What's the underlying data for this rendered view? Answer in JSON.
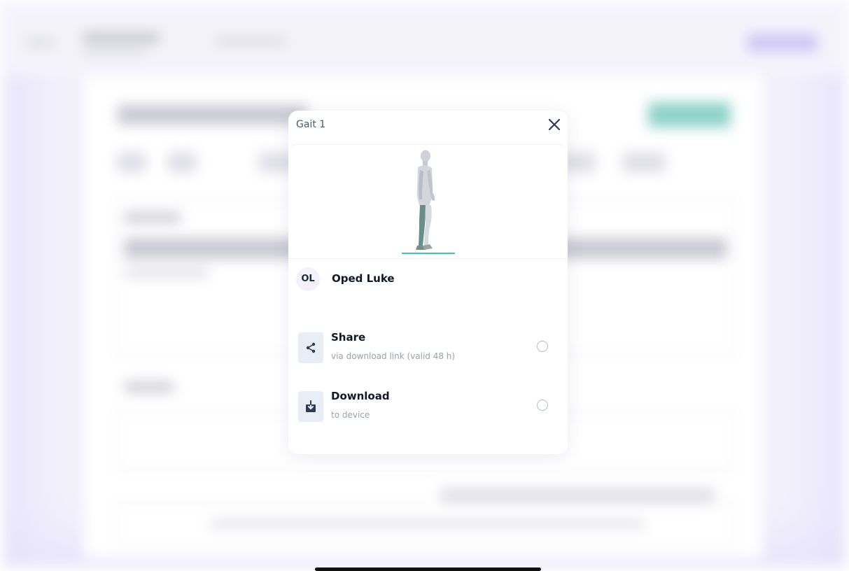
{
  "modal": {
    "title": "Gait 1",
    "close_icon": "close-icon"
  },
  "preview": {
    "figure_icon": "walking-figure-icon",
    "accent_color": "#3fc1b5"
  },
  "user": {
    "initials": "OL",
    "name": "Oped Luke"
  },
  "options": [
    {
      "icon": "share-icon",
      "title": "Share",
      "subtitle": "via download link (valid 48 h)",
      "selected": false
    },
    {
      "icon": "download-icon",
      "title": "Download",
      "subtitle": "to device",
      "selected": false
    }
  ],
  "colors": {
    "icon_color": "#2f3b52",
    "icon_bg": "#e9edf5",
    "backdrop_tint": "#e6e2fb"
  }
}
